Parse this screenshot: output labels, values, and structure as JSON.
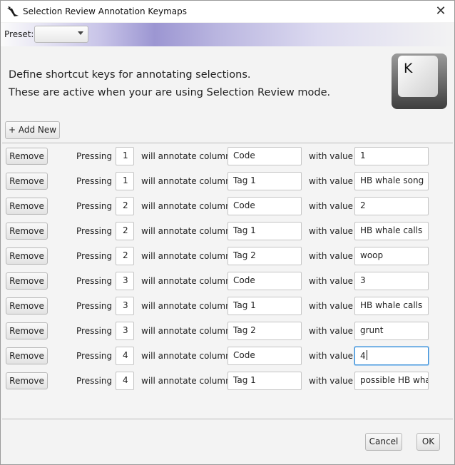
{
  "window": {
    "title": "Selection Review Annotation Keymaps",
    "close_glyph": "✕"
  },
  "preset": {
    "label": "Preset:",
    "value": ""
  },
  "intro": {
    "line1": "Define shortcut keys for annotating selections.",
    "line2": "These are active when your are using Selection Review mode."
  },
  "key_icon": {
    "letter": "K",
    "icon": "keyboard-key-icon"
  },
  "add_new_label": "+ Add New",
  "row_labels": {
    "remove": "Remove",
    "pressing": "Pressing",
    "annotate": "will annotate column",
    "with_value": "with value"
  },
  "rows": [
    {
      "key": "1",
      "column": "Code",
      "value": "1"
    },
    {
      "key": "1",
      "column": "Tag 1",
      "value": "HB whale song"
    },
    {
      "key": "2",
      "column": "Code",
      "value": "2"
    },
    {
      "key": "2",
      "column": "Tag 1",
      "value": "HB whale calls"
    },
    {
      "key": "2",
      "column": "Tag 2",
      "value": "woop"
    },
    {
      "key": "3",
      "column": "Code",
      "value": "3"
    },
    {
      "key": "3",
      "column": "Tag 1",
      "value": "HB whale calls"
    },
    {
      "key": "3",
      "column": "Tag 2",
      "value": "grunt"
    },
    {
      "key": "4",
      "column": "Code",
      "value": "4"
    },
    {
      "key": "4",
      "column": "Tag 1",
      "value": "possible HB whal"
    }
  ],
  "focused_row": 8,
  "footer": {
    "cancel": "Cancel",
    "ok": "OK"
  },
  "colors": {
    "focus": "#3a8fd8",
    "accent_gradient": "#9c96d2"
  }
}
